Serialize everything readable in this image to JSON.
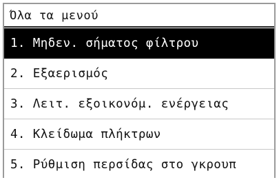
{
  "screen": {
    "title": "Όλα τα μενού"
  },
  "menu": {
    "items": [
      {
        "label": "1. Μηδεν. σήματος φίλτρου",
        "selected": true
      },
      {
        "label": "2. Εξαερισμός",
        "selected": false
      },
      {
        "label": "3. Λειτ. εξοικονόμ. ενέργειας",
        "selected": false
      },
      {
        "label": "4. Κλείδωμα πλήκτρων",
        "selected": false
      },
      {
        "label": "5. Ρύθμιση περσίδας στο γκρουπ",
        "selected": false
      }
    ]
  },
  "colors": {
    "selected_bg": "#000000",
    "selected_fg": "#ffffff",
    "text": "#111111",
    "frame": "#9a9a9a"
  }
}
